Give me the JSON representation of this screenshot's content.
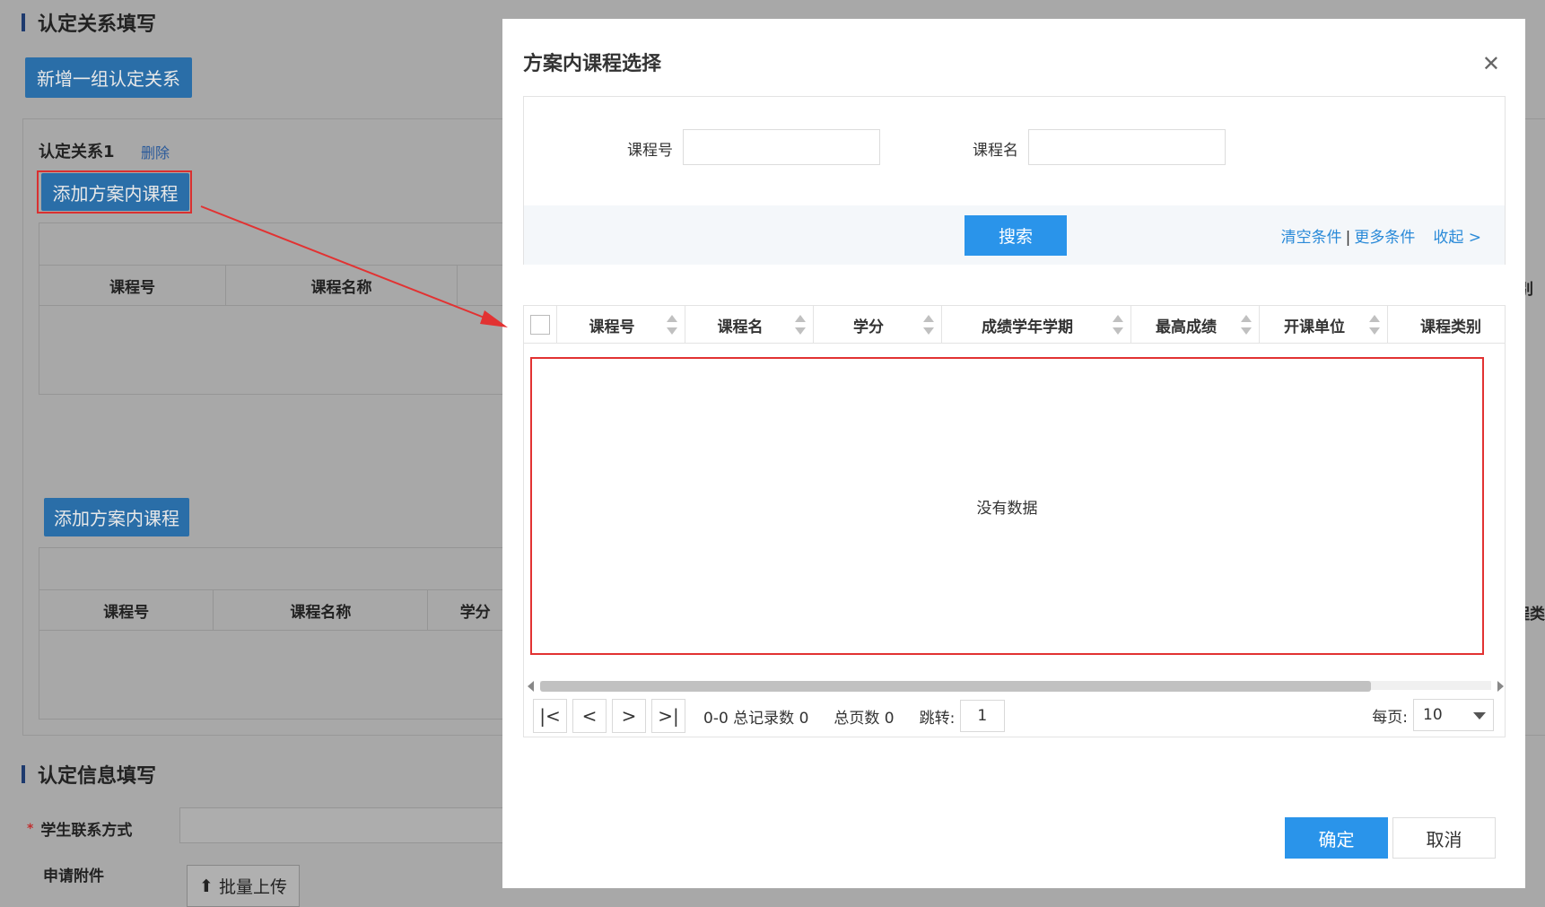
{
  "background": {
    "section1_title": "认定关系填写",
    "add_group_button": "新增一组认定关系",
    "relation_label": "认定关系1",
    "delete_link": "删除",
    "add_course_button_1": "添加方案内课程",
    "add_course_button_2": "添加方案内课程",
    "table1_headers": [
      "课程号",
      "课程名称"
    ],
    "table2_headers": [
      "课程号",
      "课程名称",
      "学分"
    ],
    "right_edge_header_1": "别",
    "right_edge_header_2": "程类",
    "section2_title": "认定信息填写",
    "contact_label": "学生联系方式",
    "required_mark": "*",
    "attachment_label": "申请附件",
    "upload_button": "批量上传"
  },
  "modal": {
    "title": "方案内课程选择",
    "close_glyph": "✕",
    "filter": {
      "course_no_label": "课程号",
      "course_no_value": "",
      "course_name_label": "课程名",
      "course_name_value": "",
      "search_button": "搜索",
      "clear_link": "清空条件",
      "separator": "|",
      "more_link": "更多条件",
      "collapse_link": "收起 >"
    },
    "grid": {
      "columns": [
        "课程号",
        "课程名",
        "学分",
        "成绩学年学期",
        "最高成绩",
        "开课单位",
        "课程类别"
      ],
      "empty_text": "没有数据"
    },
    "pager": {
      "first_glyph": "|<",
      "prev_glyph": "<",
      "next_glyph": ">",
      "last_glyph": ">|",
      "records_text": "0-0 总记录数 0",
      "pages_text": "总页数 0",
      "jump_label": "跳转:",
      "jump_value": "1",
      "per_page_label": "每页:",
      "per_page_value": "10"
    },
    "ok_button": "确定",
    "cancel_button": "取消"
  },
  "colors": {
    "primary": "#2a94ea",
    "annotation_red": "#e23232",
    "overlay_gray": "#a8a8a8"
  }
}
